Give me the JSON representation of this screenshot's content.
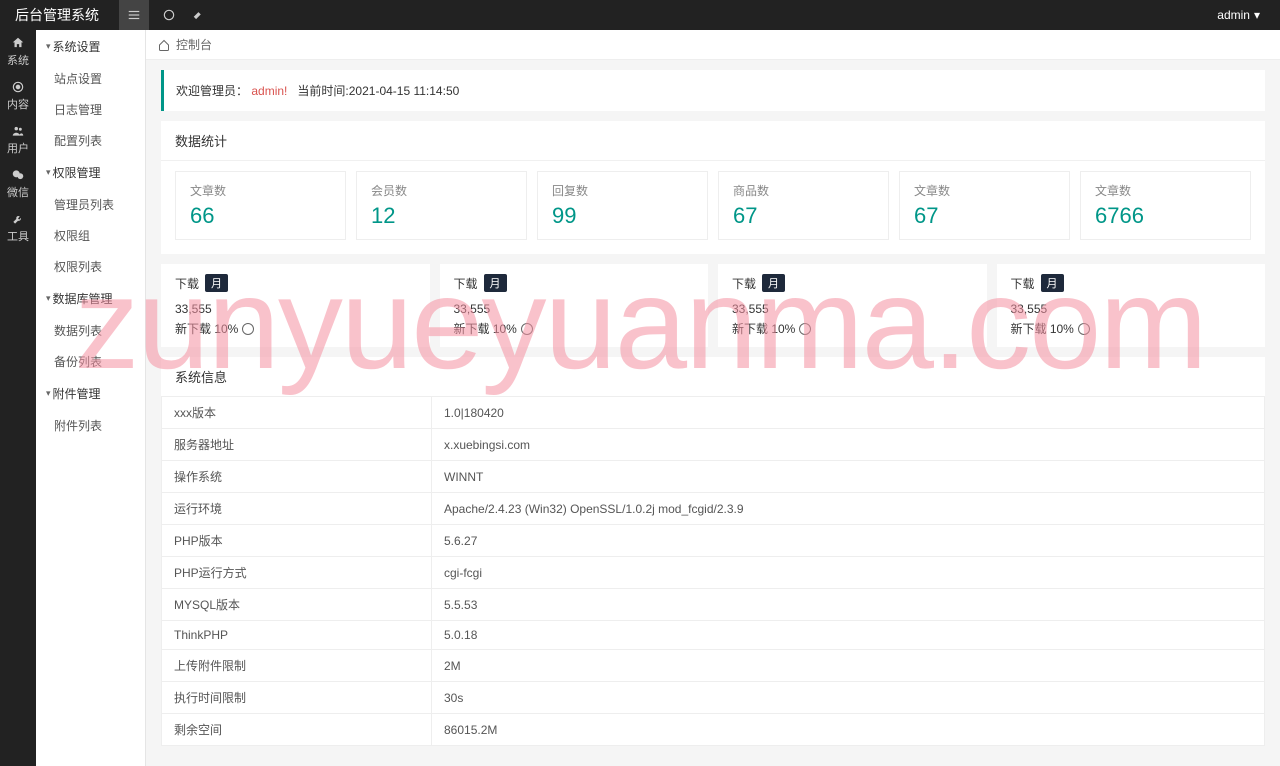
{
  "brand": "后台管理系统",
  "user": {
    "name": "admin"
  },
  "rail": [
    {
      "icon": "home",
      "label": "系统"
    },
    {
      "icon": "target",
      "label": "内容"
    },
    {
      "icon": "users",
      "label": "用户"
    },
    {
      "icon": "wechat",
      "label": "微信"
    },
    {
      "icon": "wrench",
      "label": "工具"
    }
  ],
  "sidebar": [
    {
      "type": "group",
      "label": "系统设置"
    },
    {
      "type": "item",
      "label": "站点设置"
    },
    {
      "type": "item",
      "label": "日志管理"
    },
    {
      "type": "item",
      "label": "配置列表"
    },
    {
      "type": "group",
      "label": "权限管理"
    },
    {
      "type": "item",
      "label": "管理员列表"
    },
    {
      "type": "item",
      "label": "权限组"
    },
    {
      "type": "item",
      "label": "权限列表"
    },
    {
      "type": "group",
      "label": "数据库管理"
    },
    {
      "type": "item",
      "label": "数据列表"
    },
    {
      "type": "item",
      "label": "备份列表"
    },
    {
      "type": "group",
      "label": "附件管理"
    },
    {
      "type": "item",
      "label": "附件列表"
    }
  ],
  "breadcrumb": {
    "label": "控制台"
  },
  "welcome": {
    "prefix": "欢迎管理员：",
    "admin": "admin!",
    "time_label": "当前时间:",
    "time": "2021-04-15 11:14:50"
  },
  "stats_title": "数据统计",
  "stats": [
    {
      "label": "文章数",
      "value": "66"
    },
    {
      "label": "会员数",
      "value": "12"
    },
    {
      "label": "回复数",
      "value": "99"
    },
    {
      "label": "商品数",
      "value": "67"
    },
    {
      "label": "文章数",
      "value": "67"
    },
    {
      "label": "文章数",
      "value": "6766"
    }
  ],
  "downloads": [
    {
      "title": "下载",
      "badge": "月",
      "count": "33,555",
      "rate_label": "新下载 10%"
    },
    {
      "title": "下载",
      "badge": "月",
      "count": "33,555",
      "rate_label": "新下载 10%"
    },
    {
      "title": "下载",
      "badge": "月",
      "count": "33,555",
      "rate_label": "新下载 10%"
    },
    {
      "title": "下载",
      "badge": "月",
      "count": "33,555",
      "rate_label": "新下载 10%"
    }
  ],
  "sysinfo_title": "系统信息",
  "sysinfo": [
    {
      "k": "xxx版本",
      "v": "1.0|180420"
    },
    {
      "k": "服务器地址",
      "v": "x.xuebingsi.com"
    },
    {
      "k": "操作系统",
      "v": "WINNT"
    },
    {
      "k": "运行环境",
      "v": "Apache/2.4.23 (Win32) OpenSSL/1.0.2j mod_fcgid/2.3.9"
    },
    {
      "k": "PHP版本",
      "v": "5.6.27"
    },
    {
      "k": "PHP运行方式",
      "v": "cgi-fcgi"
    },
    {
      "k": "MYSQL版本",
      "v": "5.5.53"
    },
    {
      "k": "ThinkPHP",
      "v": "5.0.18"
    },
    {
      "k": "上传附件限制",
      "v": "2M"
    },
    {
      "k": "执行时间限制",
      "v": "30s"
    },
    {
      "k": "剩余空间",
      "v": "86015.2M"
    }
  ],
  "watermark": "zunyueyuanma.com"
}
